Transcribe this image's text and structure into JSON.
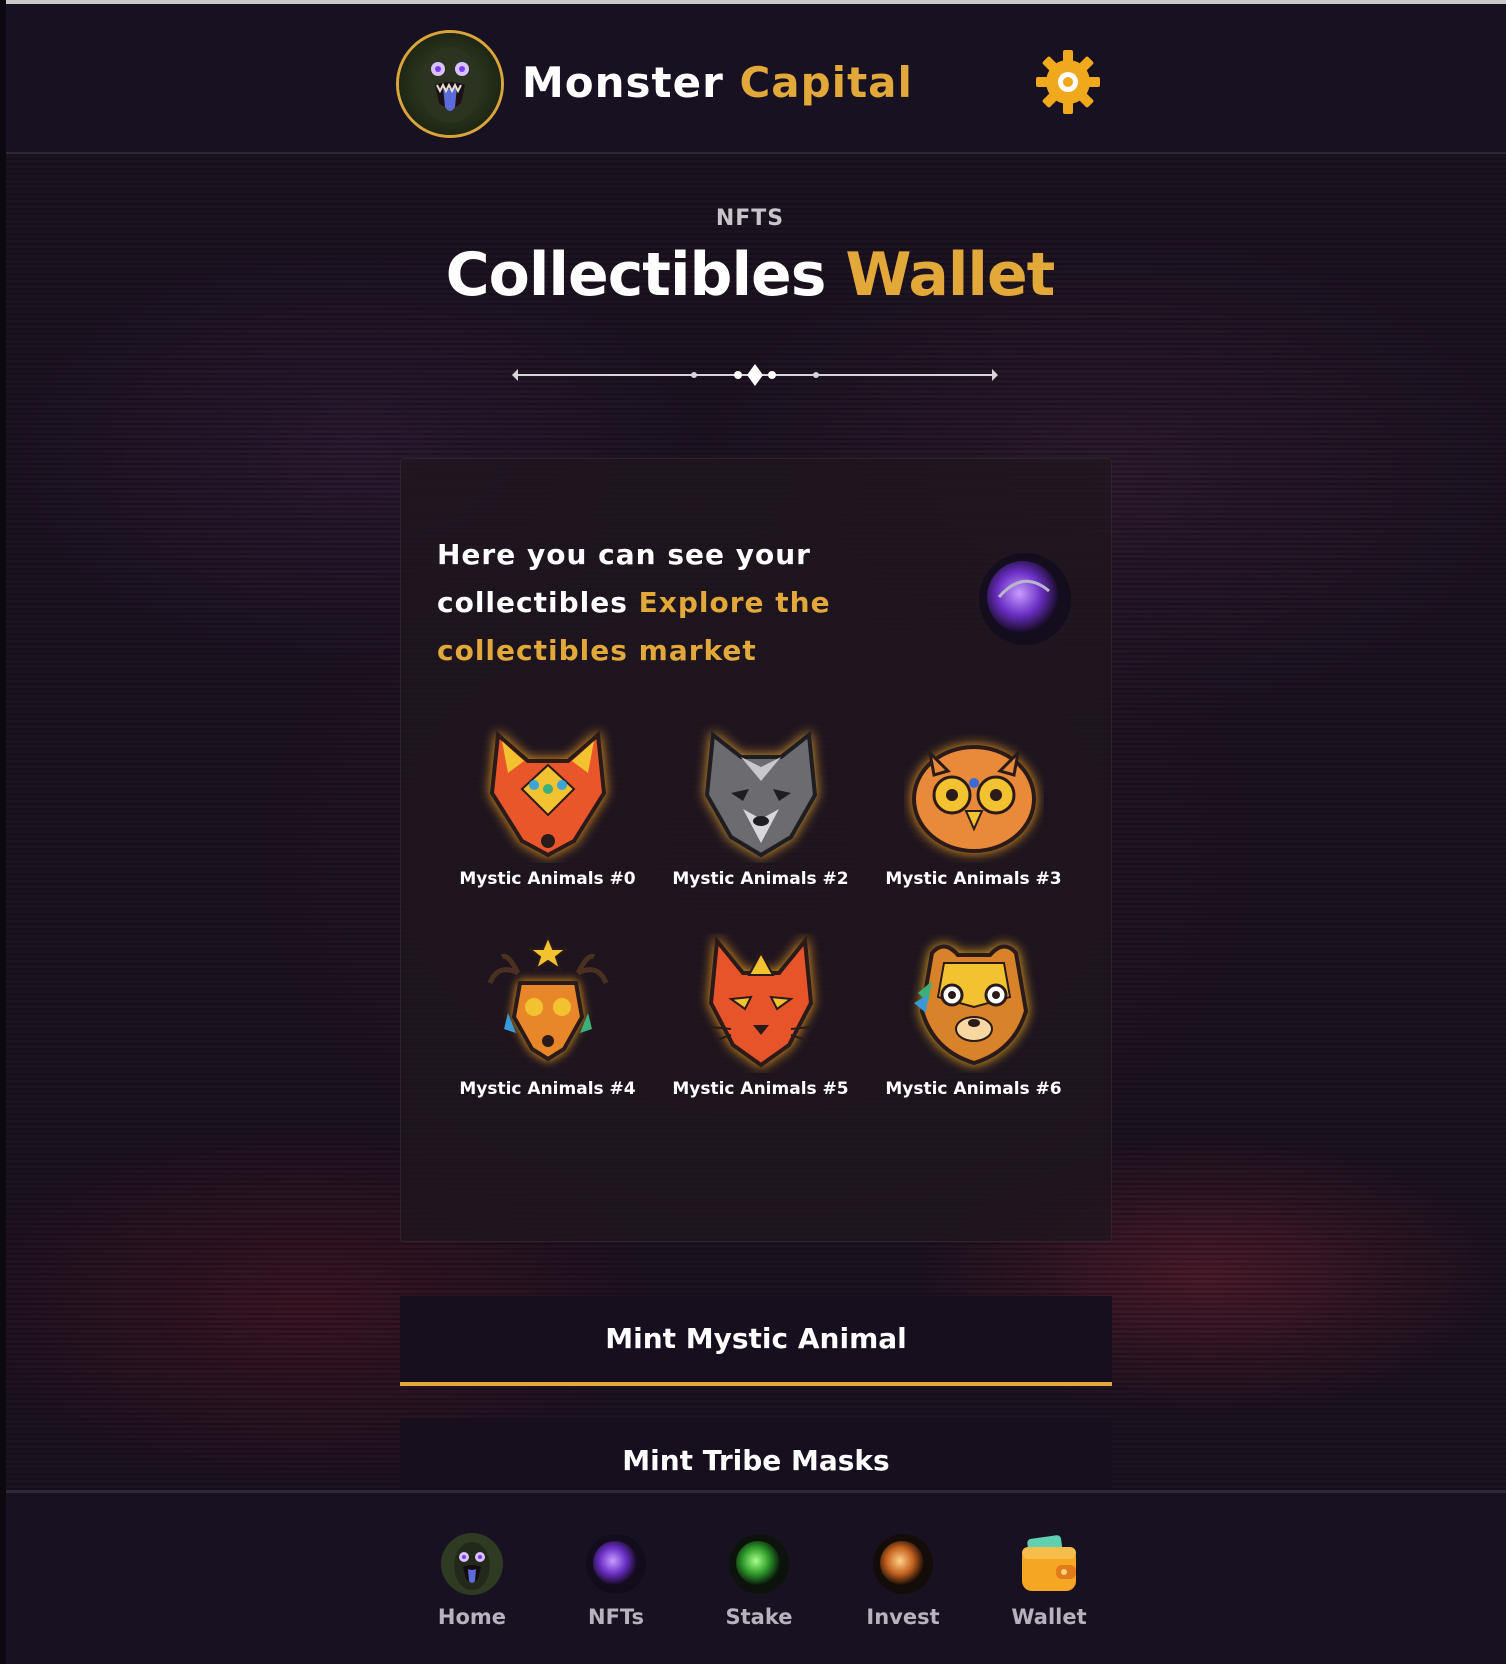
{
  "header": {
    "brand_primary": "Monster",
    "brand_accent": "Capital",
    "logo_icon": "monster-face-icon",
    "settings_icon": "gear-icon"
  },
  "page": {
    "eyebrow": "NFTS",
    "title_primary": "Collectibles",
    "title_accent": "Wallet"
  },
  "card": {
    "text_primary": "Here you can see your collectibles",
    "text_link": "Explore the collectibles market",
    "orb_icon": "purple-orb-icon",
    "items": [
      {
        "label": "Mystic Animals #0",
        "icon": "fox-mask-icon"
      },
      {
        "label": "Mystic Animals #2",
        "icon": "wolf-mask-icon"
      },
      {
        "label": "Mystic Animals #3",
        "icon": "owl-mask-icon"
      },
      {
        "label": "Mystic Animals #4",
        "icon": "deer-mask-icon"
      },
      {
        "label": "Mystic Animals #5",
        "icon": "lynx-mask-icon"
      },
      {
        "label": "Mystic Animals #6",
        "icon": "squirrel-mask-icon"
      }
    ]
  },
  "actions": {
    "mint_animal": "Mint Mystic Animal",
    "mint_masks": "Mint Tribe Masks"
  },
  "bottom_nav": [
    {
      "label": "Home",
      "icon": "monster-face-icon"
    },
    {
      "label": "NFTs",
      "icon": "purple-orb-icon"
    },
    {
      "label": "Stake",
      "icon": "green-orb-icon"
    },
    {
      "label": "Invest",
      "icon": "orange-orb-icon"
    },
    {
      "label": "Wallet",
      "icon": "wallet-icon"
    }
  ],
  "colors": {
    "accent": "#e2a83a",
    "background": "#171020",
    "nav_text": "#b7b3bd"
  }
}
